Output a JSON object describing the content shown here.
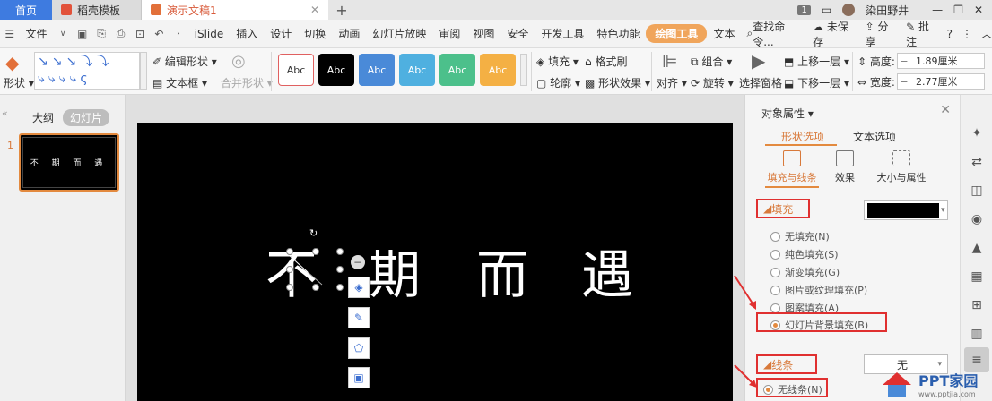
{
  "titlebar": {
    "tabs": [
      {
        "label": "首页"
      },
      {
        "label": "稻壳模板"
      },
      {
        "label": "演示文稿1"
      }
    ],
    "page_badge": "1",
    "user_name": "染田野井"
  },
  "menubar": {
    "file_label": "文件",
    "items": [
      "iSlide",
      "插入",
      "设计",
      "切换",
      "动画",
      "幻灯片放映",
      "审阅",
      "视图",
      "安全",
      "开发工具",
      "特色功能"
    ],
    "active_tab": "绘图工具",
    "extra_tab": "文本",
    "search_placeholder": "查找命令...",
    "unsaved": "未保存",
    "share": "分享",
    "comment": "批注"
  },
  "ribbon": {
    "shape_label": "形状",
    "edit_shape": "编辑形状",
    "text_box": "文本框",
    "merge_shape": "合并形状",
    "style_sample_text": "Abc",
    "style_colors": [
      "#ffffff",
      "#000000",
      "#4a8ad8",
      "#4fb0e0",
      "#4cc08b",
      "#f4b044"
    ],
    "fill": "填充",
    "format_painter": "格式刷",
    "outline": "轮廓",
    "shape_effect": "形状效果",
    "align": "对齐",
    "group": "组合",
    "rotate": "旋转",
    "select_pane": "选择窗格",
    "bring_forward": "上移一层",
    "send_backward": "下移一层",
    "height_label": "高度:",
    "height_value": "1.89厘米",
    "width_label": "宽度:",
    "width_value": "2.77厘米"
  },
  "leftpanel": {
    "tab_outline": "大纲",
    "tab_slides": "幻灯片",
    "slide_number": "1",
    "thumb_text": "不 期 而 遇"
  },
  "slide": {
    "chars": [
      "不",
      "期",
      "而",
      "遇"
    ]
  },
  "props": {
    "title": "对象属性",
    "tab_shape": "形状选项",
    "tab_text": "文本选项",
    "sub_fill_line": "填充与线条",
    "sub_effect": "效果",
    "sub_size": "大小与属性",
    "fill_section": "填充",
    "fill_options": [
      "无填充(N)",
      "纯色填充(S)",
      "渐变填充(G)",
      "图片或纹理填充(P)",
      "图案填充(A)",
      "幻灯片背景填充(B)"
    ],
    "fill_selected_index": 5,
    "fill_color": "#000000",
    "line_section": "线条",
    "line_value": "无",
    "line_option": "无线条(N)"
  },
  "watermark": {
    "text": "PPT家园",
    "url": "www.pptjia.com"
  }
}
